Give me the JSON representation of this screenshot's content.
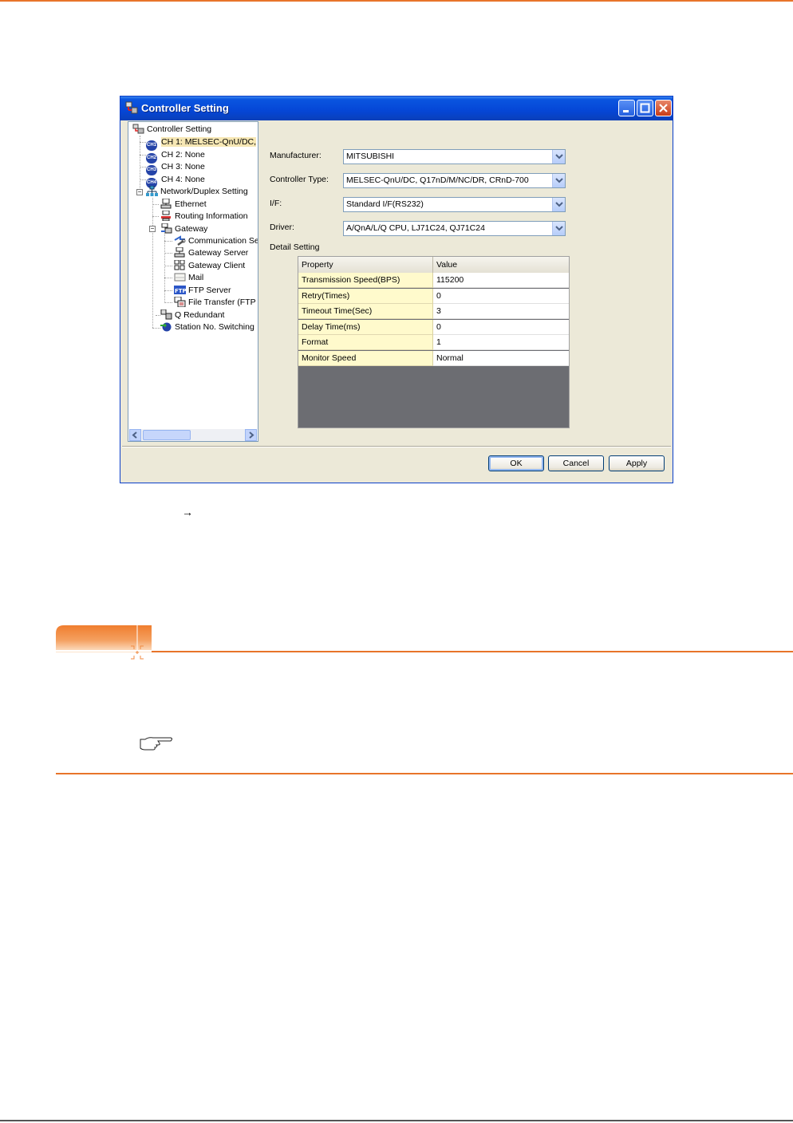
{
  "window": {
    "title": "Controller Setting"
  },
  "tree": {
    "root": "Controller Setting",
    "channels": [
      {
        "badge": "CH1",
        "label": "CH 1: MELSEC-QnU/DC,",
        "selected": true
      },
      {
        "badge": "CH2",
        "label": "CH 2: None"
      },
      {
        "badge": "CH3",
        "label": "CH 3: None"
      },
      {
        "badge": "CH4",
        "label": "CH 4: None"
      }
    ],
    "network": "Network/Duplex Setting",
    "ethernet": "Ethernet",
    "routing": "Routing Information",
    "gateway": "Gateway",
    "gateway_children": [
      "Communication Se",
      "Gateway Server",
      "Gateway Client",
      "Mail",
      "FTP Server",
      "File Transfer (FTP"
    ],
    "q_redundant": "Q Redundant",
    "station_switch": "Station No. Switching"
  },
  "form": {
    "manufacturer_label": "Manufacturer:",
    "manufacturer_value": "MITSUBISHI",
    "controller_type_label": "Controller Type:",
    "controller_type_value": "MELSEC-QnU/DC, Q17nD/M/NC/DR, CRnD-700",
    "if_label": "I/F:",
    "if_value": "Standard I/F(RS232)",
    "driver_label": "Driver:",
    "driver_value": "A/QnA/L/Q CPU, LJ71C24, QJ71C24",
    "detail_label": "Detail Setting"
  },
  "grid": {
    "headers": [
      "Property",
      "Value"
    ],
    "rows": [
      {
        "property": "Transmission Speed(BPS)",
        "value": "115200"
      },
      {
        "property": "Retry(Times)",
        "value": "0"
      },
      {
        "property": "Timeout Time(Sec)",
        "value": "3"
      },
      {
        "property": "Delay Time(ms)",
        "value": "0"
      },
      {
        "property": "Format",
        "value": "1"
      },
      {
        "property": "Monitor Speed",
        "value": "Normal"
      }
    ]
  },
  "buttons": {
    "ok": "OK",
    "cancel": "Cancel",
    "apply": "Apply"
  },
  "page": {
    "arrow": "→"
  },
  "colors": {
    "accent": "#e8742a",
    "titlebar": "#0546d6"
  }
}
